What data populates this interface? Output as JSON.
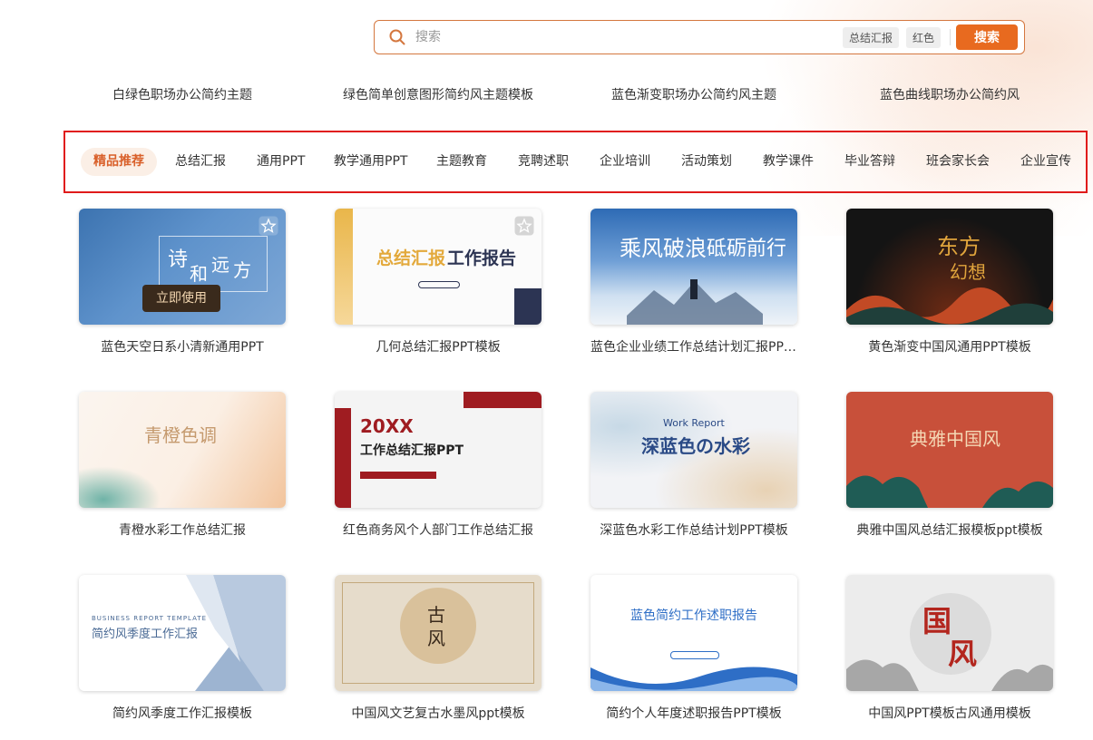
{
  "search": {
    "placeholder": "搜索",
    "tags": [
      "总结汇报",
      "红色"
    ],
    "button_label": "搜索"
  },
  "hot_links": [
    "白绿色职场办公简约主题",
    "绿色简单创意图形简约风主题模板",
    "蓝色渐变职场办公简约风主题",
    "蓝色曲线职场办公简约风"
  ],
  "categories": [
    "精品推荐",
    "总结汇报",
    "通用PPT",
    "教学通用PPT",
    "主题教育",
    "竞聘述职",
    "企业培训",
    "活动策划",
    "教学课件",
    "毕业答辩",
    "班会家长会",
    "企业宣传"
  ],
  "active_category": "精品推荐",
  "use_button_label": "立即使用",
  "templates": [
    {
      "title": "蓝色天空日系小清新通用PPT",
      "thumb_text": [
        "诗",
        "和",
        "远",
        "方"
      ],
      "colors": [
        "#3c73b0",
        "#7fa8d6"
      ]
    },
    {
      "title": "几何总结汇报PPT模板",
      "thumb_text": [
        "总结汇报",
        "工作报告"
      ],
      "colors": [
        "#fbfbfb",
        "#e3a93b"
      ]
    },
    {
      "title": "蓝色企业业绩工作总结计划汇报PPT模板",
      "thumb_text": [
        "乘风破浪",
        "砥砺前行"
      ],
      "colors": [
        "#2e6bb5",
        "#cfe0f1"
      ]
    },
    {
      "title": "黄色渐变中国风通用PPT模板",
      "thumb_text": [
        "东方",
        "幻想"
      ],
      "colors": [
        "#141414",
        "#c24a25"
      ]
    },
    {
      "title": "青橙水彩工作总结汇报",
      "thumb_text": [
        "青橙色调"
      ],
      "colors": [
        "#fbf5ef",
        "#f2c49c"
      ]
    },
    {
      "title": "红色商务风个人部门工作总结汇报",
      "thumb_text": [
        "20XX",
        "工作总结汇报PPT"
      ],
      "colors": [
        "#f4f4f4",
        "#9f1c21"
      ]
    },
    {
      "title": "深蓝色水彩工作总结计划PPT模板",
      "thumb_text": [
        "Work Report",
        "深蓝色の水彩"
      ],
      "colors": [
        "#f2f3f6",
        "#2a4a86"
      ]
    },
    {
      "title": "典雅中国风总结汇报模板ppt模板",
      "thumb_text": [
        "典雅中国风"
      ],
      "colors": [
        "#c8503a",
        "#1f5c55"
      ]
    },
    {
      "title": "简约风季度工作汇报模板",
      "thumb_text": [
        "BUSINESS REPORT TEMPLATE",
        "简约风季度工作汇报"
      ],
      "colors": [
        "#ffffff",
        "#9db4d1"
      ]
    },
    {
      "title": "中国风文艺复古水墨风ppt模板",
      "thumb_text": [
        "古",
        "风"
      ],
      "colors": [
        "#e6dccb",
        "#c3a97c"
      ]
    },
    {
      "title": "简约个人年度述职报告PPT模板",
      "thumb_text": [
        "蓝色简约工作述职报告"
      ],
      "colors": [
        "#ffffff",
        "#2e6ec6"
      ]
    },
    {
      "title": "中国风PPT模板古风通用模板",
      "thumb_text": [
        "国",
        "风"
      ],
      "colors": [
        "#ececec",
        "#b3261e"
      ]
    }
  ]
}
